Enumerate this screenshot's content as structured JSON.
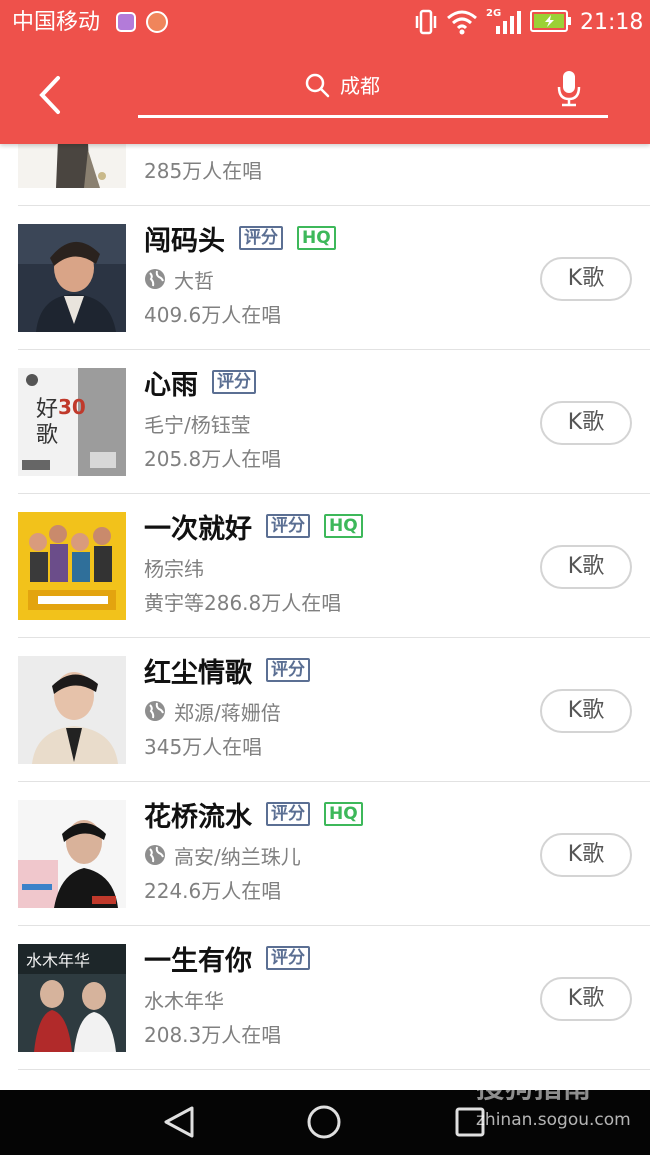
{
  "status_bar": {
    "carrier": "中国移动",
    "network": "2G",
    "time": "21:18"
  },
  "header": {
    "search_text": "成都",
    "back_icon": "chevron-left-icon",
    "search_icon": "search-icon",
    "mic_icon": "microphone-icon",
    "background_color": "#ee514b"
  },
  "partial_row": {
    "count": "285万人在唱",
    "k_button": "K歌"
  },
  "songs": [
    {
      "title": "闯码头",
      "score_tag": "评分",
      "hq_tag": "HQ",
      "has_globe": true,
      "artist": "大哲",
      "count": "409.6万人在唱",
      "k_button": "K歌"
    },
    {
      "title": "心雨",
      "score_tag": "评分",
      "hq_tag": "",
      "has_globe": false,
      "artist": "毛宁/杨钰莹",
      "count": "205.8万人在唱",
      "k_button": "K歌"
    },
    {
      "title": "一次就好",
      "score_tag": "评分",
      "hq_tag": "HQ",
      "has_globe": false,
      "artist": "杨宗纬",
      "count": "黄宇等286.8万人在唱",
      "k_button": "K歌"
    },
    {
      "title": "红尘情歌",
      "score_tag": "评分",
      "hq_tag": "",
      "has_globe": true,
      "artist": "郑源/蒋姗倍",
      "count": "345万人在唱",
      "k_button": "K歌"
    },
    {
      "title": "花桥流水",
      "score_tag": "评分",
      "hq_tag": "HQ",
      "has_globe": true,
      "artist": "高安/纳兰珠儿",
      "count": "224.6万人在唱",
      "k_button": "K歌"
    },
    {
      "title": "一生有你",
      "score_tag": "评分",
      "hq_tag": "",
      "has_globe": false,
      "artist": "水木年华",
      "count": "208.3万人在唱",
      "k_button": "K歌"
    }
  ],
  "nav_bar": {
    "back_icon": "triangle-back-icon",
    "home_icon": "circle-home-icon",
    "recent_icon": "square-recents-icon"
  },
  "watermark": {
    "logo_text": "搜狗指南",
    "url": "zhinan.sogou.com"
  },
  "colors": {
    "accent": "#ee514b",
    "score_tag": "#5b6f93",
    "hq_tag": "#3db85a",
    "secondary_text": "#808080"
  }
}
